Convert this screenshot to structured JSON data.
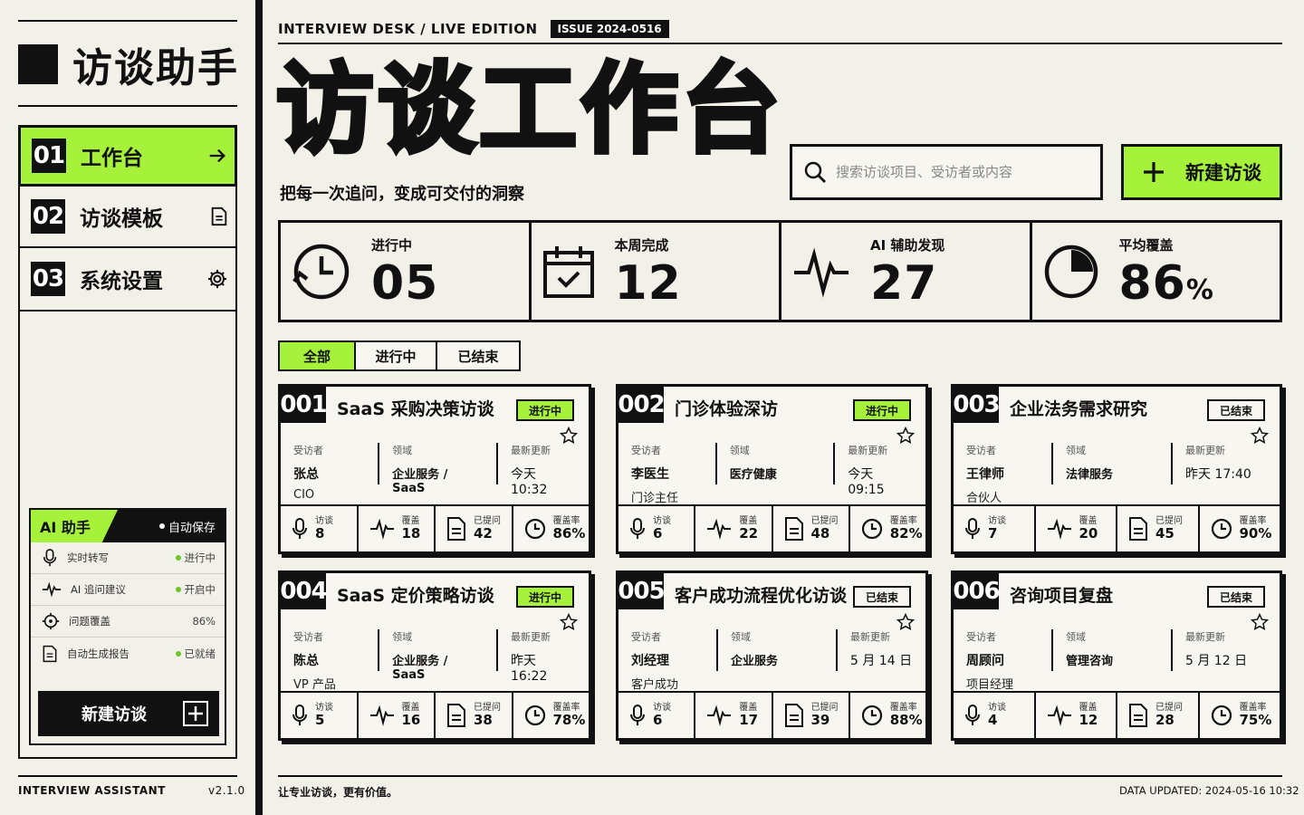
{
  "brand": {
    "title": "访谈助手"
  },
  "nav": [
    {
      "num": "01",
      "label": "工作台",
      "icon": "arrow-right-icon"
    },
    {
      "num": "02",
      "label": "访谈模板",
      "icon": "document-icon"
    },
    {
      "num": "03",
      "label": "系统设置",
      "icon": "gear-icon"
    }
  ],
  "ai": {
    "title": "AI 助手",
    "autosave": "自动保存",
    "rows": [
      {
        "name": "实时转写",
        "status": "进行中",
        "dot": true
      },
      {
        "name": "AI 追问建议",
        "status": "开启中",
        "dot": true
      },
      {
        "name": "问题覆盖",
        "status": "86%",
        "dot": false
      },
      {
        "name": "自动生成报告",
        "status": "已就绪",
        "dot": true
      }
    ],
    "button": "新建访谈"
  },
  "sidebar_footer": {
    "left": "INTERVIEW ASSISTANT",
    "right": "v2.1.0"
  },
  "header": {
    "edition": "INTERVIEW DESK / LIVE EDITION",
    "issue": "ISSUE 2024-0516"
  },
  "title": "访谈工作台",
  "subtitle": "把每一次追问，变成可交付的洞察",
  "search": {
    "placeholder": "搜索访谈项目、受访者或内容"
  },
  "new_button": "新建访谈",
  "stats": [
    {
      "label": "进行中",
      "value": "05",
      "unit": "",
      "icon": "clock-icon"
    },
    {
      "label": "本周完成",
      "value": "12",
      "unit": "",
      "icon": "calendar-check-icon"
    },
    {
      "label": "AI 辅助发现",
      "value": "27",
      "unit": "",
      "icon": "pulse-icon"
    },
    {
      "label": "平均覆盖",
      "value": "86",
      "unit": "%",
      "icon": "pie-icon",
      "fraction": 0.86
    }
  ],
  "tabs": [
    "全部",
    "进行中",
    "已结束"
  ],
  "meta_labels": {
    "interviewee": "受访者",
    "domain": "领域",
    "updated": "最新更新"
  },
  "foot_labels": {
    "interviews": "访谈",
    "coverage": "覆盖",
    "asked": "已提问",
    "rate": "覆盖率"
  },
  "cards": [
    {
      "id": "001",
      "title": "SaaS 采购决策访谈",
      "status": "进行中",
      "running": true,
      "person": "张总",
      "role": "CIO",
      "domain": "企业服务 / SaaS",
      "updated": "今天  10:32",
      "interviews": "8",
      "coverage": "18",
      "asked": "42",
      "rate": "86%"
    },
    {
      "id": "002",
      "title": "门诊体验深访",
      "status": "进行中",
      "running": true,
      "person": "李医生",
      "role": "门诊主任",
      "domain": "医疗健康",
      "updated": "今天  09:15",
      "interviews": "6",
      "coverage": "22",
      "asked": "48",
      "rate": "82%"
    },
    {
      "id": "003",
      "title": "企业法务需求研究",
      "status": "已结束",
      "running": false,
      "person": "王律师",
      "role": "合伙人",
      "domain": "法律服务",
      "updated": "昨天  17:40",
      "interviews": "7",
      "coverage": "20",
      "asked": "45",
      "rate": "90%"
    },
    {
      "id": "004",
      "title": "SaaS 定价策略访谈",
      "status": "进行中",
      "running": true,
      "person": "陈总",
      "role": "VP 产品",
      "domain": "企业服务 / SaaS",
      "updated": "昨天  16:22",
      "interviews": "5",
      "coverage": "16",
      "asked": "38",
      "rate": "78%"
    },
    {
      "id": "005",
      "title": "客户成功流程优化访谈",
      "status": "已结束",
      "running": false,
      "person": "刘经理",
      "role": "客户成功",
      "domain": "企业服务",
      "updated": "5 月 14 日",
      "interviews": "6",
      "coverage": "17",
      "asked": "39",
      "rate": "88%"
    },
    {
      "id": "006",
      "title": "咨询项目复盘",
      "status": "已结束",
      "running": false,
      "person": "周顾问",
      "role": "项目经理",
      "domain": "管理咨询",
      "updated": "5 月 12 日",
      "interviews": "4",
      "coverage": "12",
      "asked": "28",
      "rate": "75%"
    }
  ],
  "footer": {
    "slogan": "让专业访谈，更有价值。",
    "updated": "DATA UPDATED:  2024-05-16  10:32"
  }
}
